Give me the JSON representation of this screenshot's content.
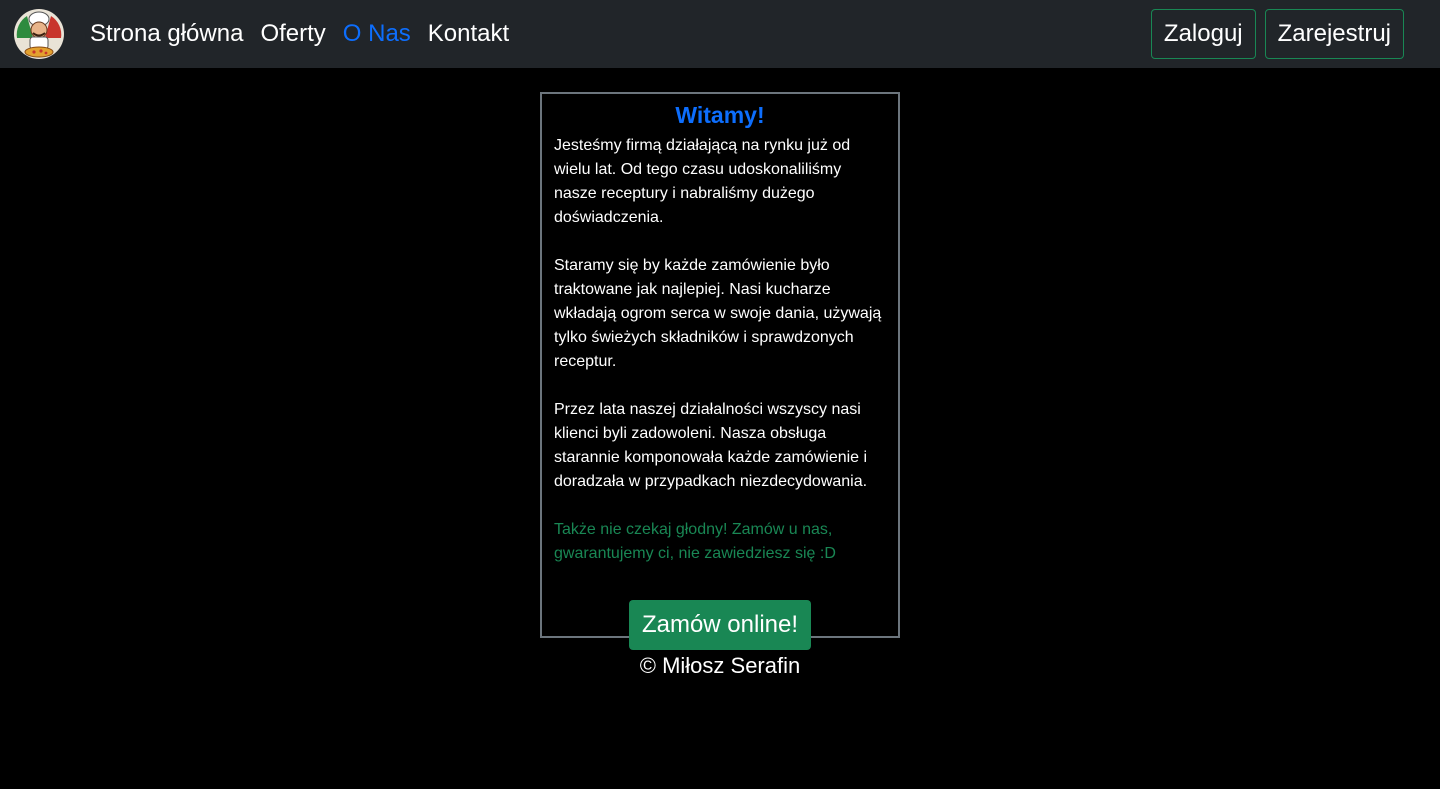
{
  "nav": {
    "logo_icon": "chef-pizza-logo",
    "links": [
      {
        "label": "Strona główna",
        "active": false
      },
      {
        "label": "Oferty",
        "active": false
      },
      {
        "label": "O Nas",
        "active": true
      },
      {
        "label": "Kontakt",
        "active": false
      }
    ],
    "login_label": "Zaloguj",
    "register_label": "Zarejestruj"
  },
  "card": {
    "title": "Witamy!",
    "paragraphs": [
      "Jesteśmy firmą działającą na rynku już od wielu lat. Od tego czasu udoskonaliliśmy nasze receptury i nabraliśmy dużego doświadczenia.",
      "Staramy się by każde zamówienie było traktowane jak najlepiej. Nasi kucharze wkładają ogrom serca w swoje dania, używają tylko świeżych składników i sprawdzonych receptur.",
      "Przez lata naszej działalności wszyscy nasi klienci byli zadowoleni. Nasza obsługa starannie komponowała każde zamówienie i doradzała w przypadkach niezdecydowania."
    ],
    "closing": "Także nie czekaj głodny! Zamów u nas, gwarantujemy ci, nie zawiedziesz się :D",
    "order_button": "Zamów online!"
  },
  "footer": {
    "copyright": "© Miłosz Serafin"
  },
  "colors": {
    "navbar_bg": "#212529",
    "accent_blue": "#0d6efd",
    "success_green": "#198754",
    "card_border": "#6c757d"
  }
}
